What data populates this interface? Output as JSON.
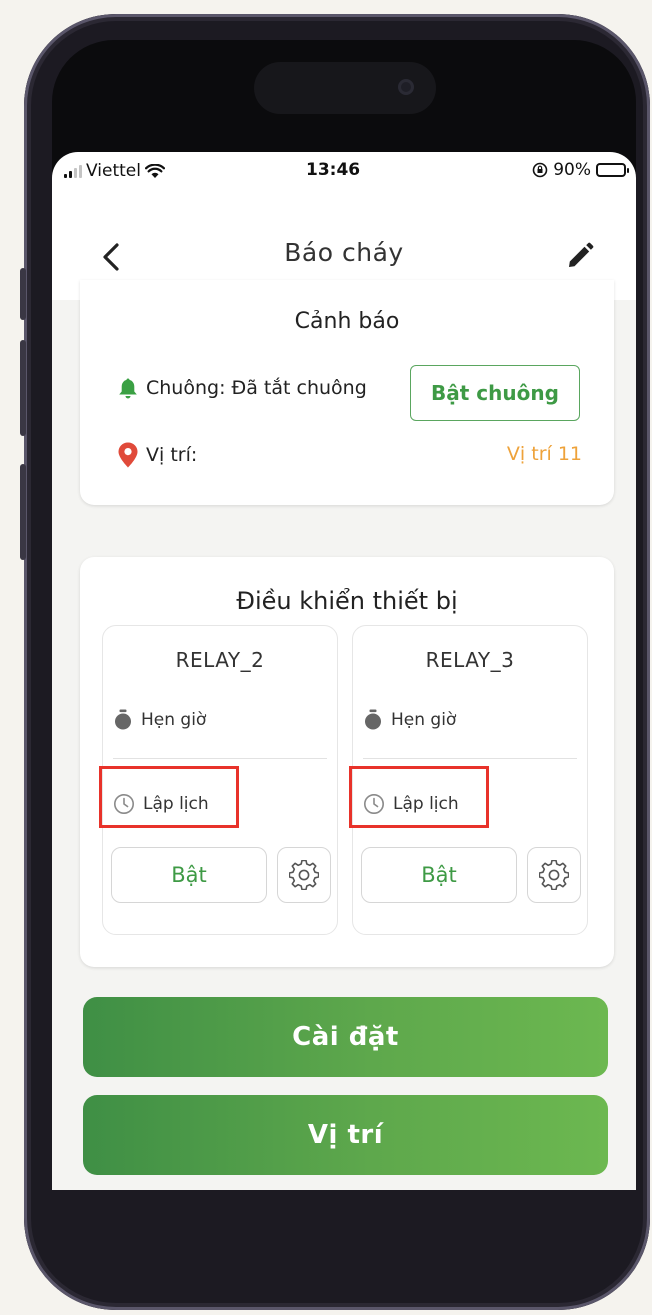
{
  "status_bar": {
    "carrier": "Viettel",
    "time": "13:46",
    "battery_text": "90%"
  },
  "header": {
    "title": "Báo cháy"
  },
  "alert_card": {
    "title": "Cảnh báo",
    "bell_label": "Chuông: Đã tắt chuông",
    "bell_button": "Bật chuông",
    "location_label": "Vị trí:",
    "location_value": "Vị trí 11"
  },
  "device_card": {
    "title": "Điều khiển thiết bị",
    "relays": [
      {
        "name": "RELAY_2",
        "timer_label": "Hẹn giờ",
        "schedule_label": "Lập lịch",
        "on_button": "Bật"
      },
      {
        "name": "RELAY_3",
        "timer_label": "Hẹn giờ",
        "schedule_label": "Lập lịch",
        "on_button": "Bật"
      }
    ]
  },
  "buttons": {
    "settings": "Cài đặt",
    "location": "Vị trí"
  },
  "icons": {
    "back": "chevron-left-icon",
    "edit": "pencil-icon",
    "bell": "bell-icon",
    "location": "map-pin-icon",
    "timer": "stopwatch-icon",
    "schedule": "clock-icon",
    "settings": "gear-icon"
  },
  "colors": {
    "brand_green": "#4e9f4c",
    "bell_green": "#3aa043",
    "pin_red": "#e04a3a",
    "location_orange": "#eea23a",
    "highlight_red": "#e8322a"
  }
}
